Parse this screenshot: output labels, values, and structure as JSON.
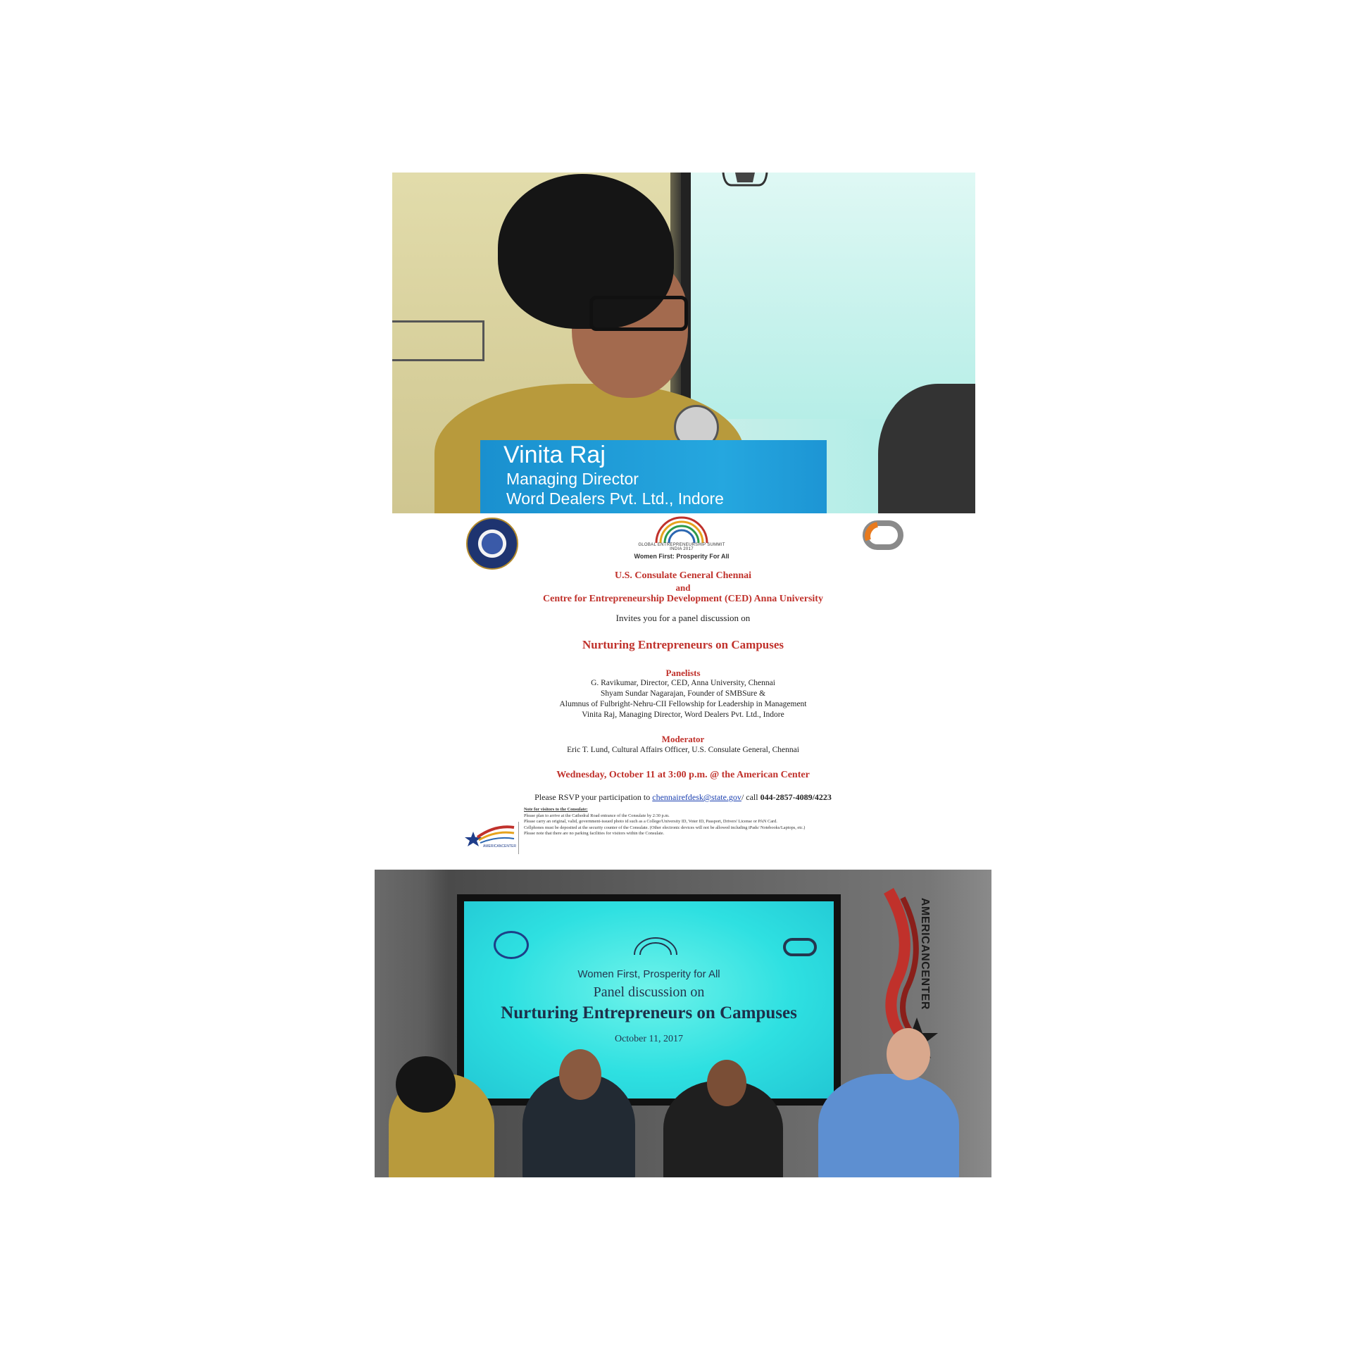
{
  "top_photo": {
    "name": "Vinita Raj",
    "title": "Managing Director",
    "company": "Word Dealers Pvt. Ltd., Indore"
  },
  "invitation": {
    "logo_tagline": "Women First: Prosperity For All",
    "logo_summit_text": "GLOBAL ENTREPRENEURSHIP SUMMIT",
    "logo_summit_sub": "INDIA 2017",
    "host1": "U.S. Consulate General Chennai",
    "conjunction": "and",
    "host2": "Centre for Entrepreneurship Development (CED) Anna University",
    "invites": "Invites you for a panel discussion on",
    "event_title": "Nurturing Entrepreneurs on Campuses",
    "panelists_heading": "Panelists",
    "panelists": [
      "G. Ravikumar, Director, CED, Anna University, Chennai",
      "Shyam Sundar Nagarajan, Founder of  SMBSure &",
      "Alumnus of  Fulbright-Nehru-CII Fellowship for Leadership in Management",
      "Vinita Raj, Managing Director, Word Dealers Pvt. Ltd., Indore"
    ],
    "moderator_heading": "Moderator",
    "moderator": "Eric T. Lund, Cultural Affairs Officer, U.S. Consulate General, Chennai",
    "datetime": "Wednesday, October 11 at 3:00 p.m. @ the American Center",
    "rsvp_prefix": "Please RSVP your participation to ",
    "rsvp_email": "chennairefdesk@state.gov",
    "rsvp_suffix": "/ call ",
    "rsvp_phone": "044-2857-4089/4223",
    "notes_heading": "Note for visitors to the Consulate:",
    "notes": [
      "Please plan to arrive at the Cathedral Road entrance of the Consulate by 2:30 p.m.",
      "Please carry an original, valid, government-issued photo id such as a College/University ID, Voter ID, Passport, Drivers' License or PAN Card.",
      "Cellphones must be deposited at the security counter of the Consulate. (Other electronic devices will not be allowed including iPads/ Notebooks/Laptops, etc.)",
      "Please note that there are no parking facilities for visitors within the Consulate."
    ],
    "american_center_logo_text": "AMERICANCENTER"
  },
  "bottom_photo": {
    "screen_tagline": "Women First, Prosperity for All",
    "screen_subtitle": "Panel discussion on",
    "screen_title": "Nurturing Entrepreneurs on Campuses",
    "screen_date": "October 11, 2017",
    "banner_text": "AMERICANCENTER"
  },
  "colors": {
    "invitation_red": "#c0312b",
    "lower_third_blue": "#25a7df",
    "screen_cyan": "#2ee0e1"
  }
}
